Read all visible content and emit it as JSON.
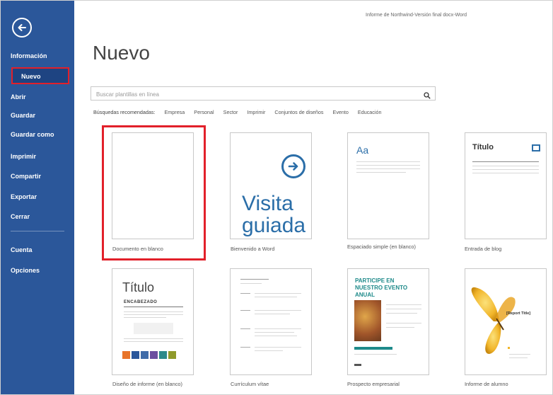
{
  "window": {
    "title": "Informe de Northwind-Versión final docx-Word"
  },
  "sidebar": {
    "items": [
      {
        "id": "informacion",
        "label": "Información"
      },
      {
        "id": "nuevo",
        "label": "Nuevo"
      },
      {
        "id": "abrir",
        "label": "Abrir"
      },
      {
        "id": "guardar",
        "label": "Guardar"
      },
      {
        "id": "guardar-como",
        "label": "Guardar como"
      },
      {
        "id": "imprimir",
        "label": "Imprimir"
      },
      {
        "id": "compartir",
        "label": "Compartir"
      },
      {
        "id": "exportar",
        "label": "Exportar"
      },
      {
        "id": "cerrar",
        "label": "Cerrar"
      },
      {
        "id": "cuenta",
        "label": "Cuenta"
      },
      {
        "id": "opciones",
        "label": "Opciones"
      }
    ],
    "active": "nuevo",
    "accent": "#2b579a",
    "highlight": "#e2202a"
  },
  "main": {
    "title": "Nuevo",
    "search": {
      "placeholder": "Buscar plantillas en línea"
    },
    "suggested": [
      "Búsquedas recomendadas:",
      "Empresa",
      "Personal",
      "Sector",
      "Imprimir",
      "Conjuntos de diseños",
      "Evento",
      "Educación"
    ],
    "templates": [
      {
        "label": "Documento en blanco"
      },
      {
        "label": "Bienvenido a Word",
        "thumb_text": "Visita guiada"
      },
      {
        "label": "Espaciado simple (en blanco)",
        "thumb_text": "Aa"
      },
      {
        "label": "Entrada de blog",
        "thumb_text": "Título"
      },
      {
        "label": "Diseño de informe (en blanco)",
        "thumb_text": "Título",
        "thumb_sub": "ENCABEZADO"
      },
      {
        "label": "Currículum vítae"
      },
      {
        "label": "Prospecto empresarial",
        "thumb_text": "PARTICIPE EN NUESTRO EVENTO ANUAL"
      },
      {
        "label": "Informe de alumno",
        "thumb_text": "[Report Title]"
      }
    ]
  }
}
